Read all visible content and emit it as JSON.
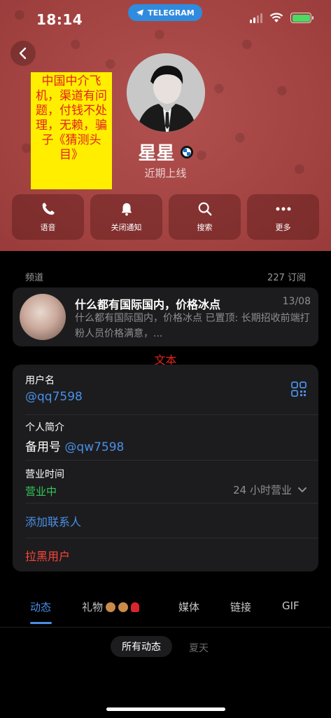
{
  "status_bar": {
    "time": "18:14",
    "app_pill": "TELEGRAM"
  },
  "warning_text": "中国中介飞机，渠道有问题，付钱不处理，无赖，骗子《猜测头目》",
  "profile": {
    "name": "星星",
    "badge_icon": "bmw-logo-icon",
    "status": "近期上线"
  },
  "actions": [
    {
      "label": "语音",
      "icon": "phone-icon"
    },
    {
      "label": "关闭通知",
      "icon": "bell-icon"
    },
    {
      "label": "搜索",
      "icon": "search-icon"
    },
    {
      "label": "更多",
      "icon": "more-icon"
    }
  ],
  "channel_section": {
    "label": "频道",
    "subscribers": "227 订阅"
  },
  "channel": {
    "title": "什么都有国际国内，价格冰点",
    "date": "13/08",
    "preview": "什么都有国际国内，价格冰点 已置顶: 长期招收前端打粉人员价格满意，..."
  },
  "annotation_text": "文本",
  "info": {
    "username_label": "用户名",
    "username": "@qq7598",
    "bio_label": "个人简介",
    "bio_prefix": "备用号",
    "bio_link": "@qw7598",
    "hours_label": "营业时间",
    "hours_status": "营业中",
    "hours_value": "24 小时营业",
    "add_contact": "添加联系人",
    "block_user": "拉黑用户"
  },
  "tabs": [
    {
      "label": "动态",
      "active": true
    },
    {
      "label": "礼物",
      "active": false
    },
    {
      "label": "媒体",
      "active": false
    },
    {
      "label": "链接",
      "active": false
    },
    {
      "label": "GIF",
      "active": false
    }
  ],
  "filters": {
    "selected": "所有动态",
    "other": "夏天"
  },
  "colors": {
    "header_bg": "#a54543",
    "accent_blue": "#4a8fe7",
    "open_green": "#35c759",
    "block_red": "#ff453a",
    "warning_yellow": "#ffee00"
  }
}
